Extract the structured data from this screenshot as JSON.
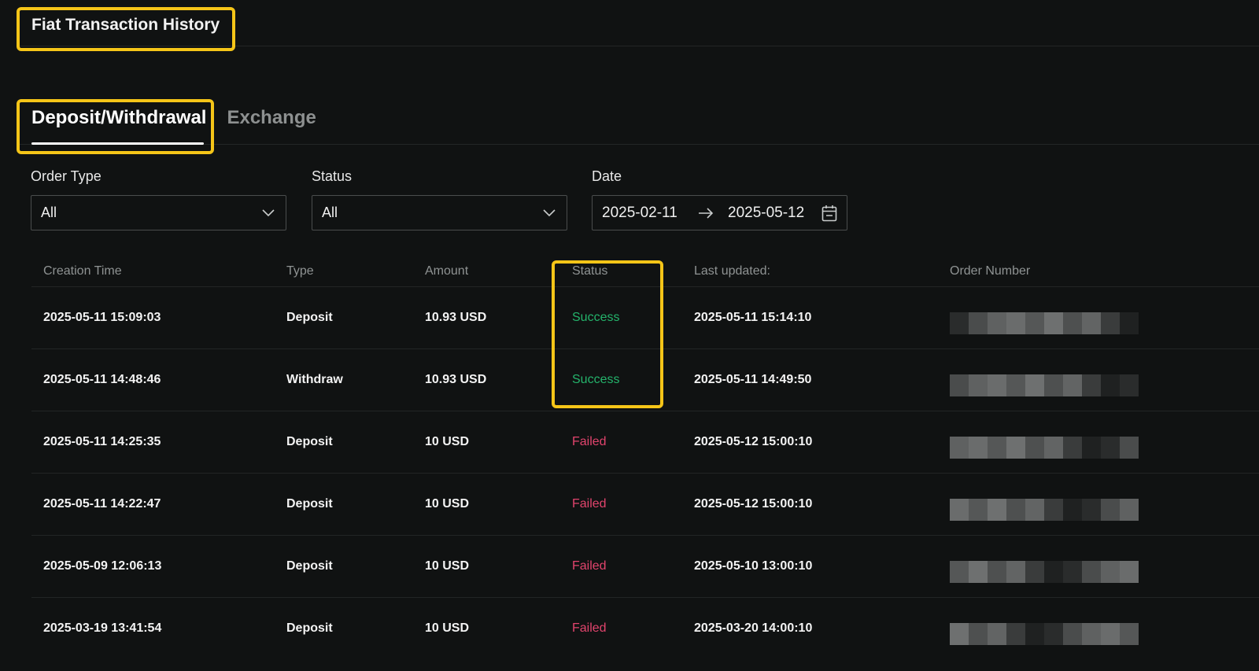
{
  "header": {
    "title": "Fiat Transaction History"
  },
  "tabs": [
    {
      "label": "Deposit/Withdrawal",
      "active": true
    },
    {
      "label": "Exchange",
      "active": false
    }
  ],
  "filters": {
    "order_type": {
      "label": "Order Type",
      "value": "All"
    },
    "status": {
      "label": "Status",
      "value": "All"
    },
    "date": {
      "label": "Date",
      "start": "2025-02-11",
      "end": "2025-05-12"
    }
  },
  "table": {
    "columns": [
      "Creation Time",
      "Type",
      "Amount",
      "Status",
      "Last updated:",
      "Order Number"
    ],
    "rows": [
      {
        "created": "2025-05-11 15:09:03",
        "type": "Deposit",
        "amount": "10.93 USD",
        "status": "Success",
        "updated": "2025-05-11 15:14:10"
      },
      {
        "created": "2025-05-11 14:48:46",
        "type": "Withdraw",
        "amount": "10.93 USD",
        "status": "Success",
        "updated": "2025-05-11 14:49:50"
      },
      {
        "created": "2025-05-11 14:25:35",
        "type": "Deposit",
        "amount": "10 USD",
        "status": "Failed",
        "updated": "2025-05-12 15:00:10"
      },
      {
        "created": "2025-05-11 14:22:47",
        "type": "Deposit",
        "amount": "10 USD",
        "status": "Failed",
        "updated": "2025-05-12 15:00:10"
      },
      {
        "created": "2025-05-09 12:06:13",
        "type": "Deposit",
        "amount": "10 USD",
        "status": "Failed",
        "updated": "2025-05-10 13:00:10"
      },
      {
        "created": "2025-03-19 13:41:54",
        "type": "Deposit",
        "amount": "10 USD",
        "status": "Failed",
        "updated": "2025-03-20 14:00:10"
      }
    ]
  },
  "colors": {
    "success": "#24b36b",
    "failed": "#e2446d",
    "highlight": "#f5c518",
    "background": "#101212"
  },
  "icons": {
    "select_chevron": "chevron-down-icon",
    "date_arrow": "arrow-right-icon",
    "date_picker": "calendar-icon"
  }
}
